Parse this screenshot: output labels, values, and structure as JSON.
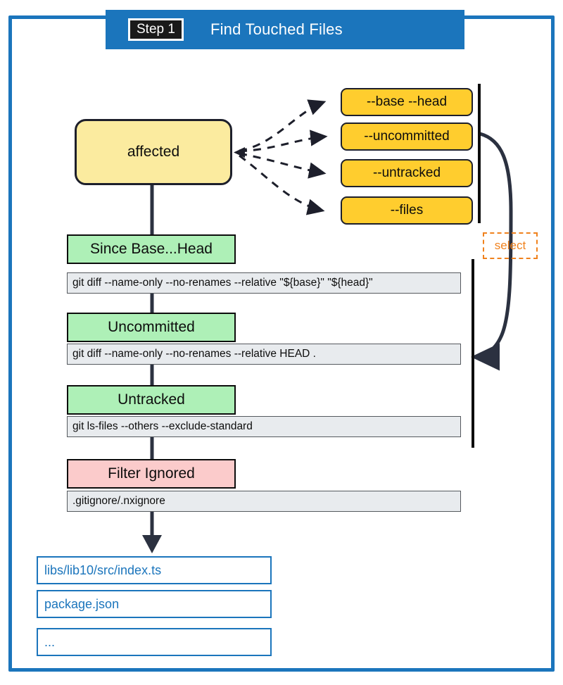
{
  "header": {
    "step_badge": "Step 1",
    "title": "Find Touched Files",
    "banner_color": "#1b75bc"
  },
  "frame": {
    "border_color": "#1b75bc"
  },
  "source_node": {
    "label": "affected",
    "fill": "#fbeb9f",
    "border": "#1d1f2b"
  },
  "flags": {
    "fill": "#ffcd2e",
    "items": [
      {
        "label": "--base --head"
      },
      {
        "label": "--uncommitted"
      },
      {
        "label": "--untracked"
      },
      {
        "label": "--files"
      }
    ]
  },
  "select": {
    "label": "select",
    "color": "#f0821e"
  },
  "pipeline": [
    {
      "title": "Since Base...Head",
      "tone": "green",
      "fill": "#aef0b7",
      "command": "git diff --name-only --no-renames --relative \"${base}\" \"${head}\""
    },
    {
      "title": "Uncommitted",
      "tone": "green",
      "fill": "#aef0b7",
      "command": "git diff --name-only --no-renames --relative HEAD ."
    },
    {
      "title": "Untracked",
      "tone": "green",
      "fill": "#aef0b7",
      "command": "git ls-files --others --exclude-standard"
    },
    {
      "title": "Filter Ignored",
      "tone": "pink",
      "fill": "#fbcbcb",
      "command": ".gitignore/.nxignore"
    }
  ],
  "outputs": [
    {
      "label": "libs/lib10/src/index.ts"
    },
    {
      "label": "package.json"
    },
    {
      "label": "..."
    }
  ],
  "colors": {
    "accent_blue": "#1b75bc",
    "flag_yellow": "#ffcd2e",
    "node_yellow": "#fbeb9f",
    "green": "#aef0b7",
    "pink": "#fbcbcb",
    "code_gray": "#e8ebee",
    "orange": "#f0821e",
    "ink": "#1d1f2b"
  }
}
